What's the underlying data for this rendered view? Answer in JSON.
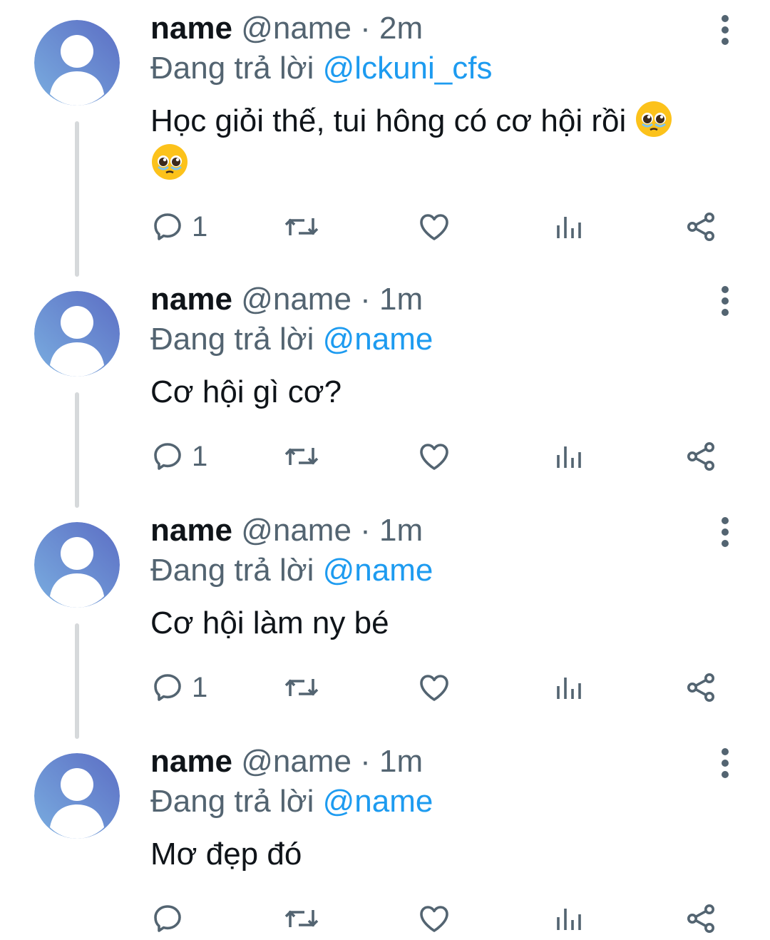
{
  "tweets": [
    {
      "display_name": "name",
      "handle": "@name",
      "separator": " · ",
      "time": "2m",
      "replying_label": "Đang trả lời ",
      "reply_to": "@lckuni_cfs",
      "text": "Học giỏi thế, tui hông có cơ hội rồi",
      "emoji": "🥹 🥹",
      "reply_count": "1"
    },
    {
      "display_name": "name",
      "handle": "@name",
      "separator": " · ",
      "time": "1m",
      "replying_label": "Đang trả lời ",
      "reply_to": "@name",
      "text": "Cơ hội gì cơ?",
      "reply_count": "1"
    },
    {
      "display_name": "name",
      "handle": "@name",
      "separator": " · ",
      "time": "1m",
      "replying_label": "Đang trả lời ",
      "reply_to": "@name",
      "text": "Cơ hội làm ny bé",
      "reply_count": "1"
    },
    {
      "display_name": "name",
      "handle": "@name",
      "separator": " · ",
      "time": "1m",
      "replying_label": "Đang trả lời ",
      "reply_to": "@name",
      "text": "Mơ đẹp đó",
      "reply_count": ""
    }
  ],
  "colors": {
    "text_primary": "#0f1419",
    "text_secondary": "#536471",
    "mention": "#1d9bf0",
    "thread_line": "#d6d9db",
    "avatar_gradient_start": "#7aaee0",
    "avatar_gradient_end": "#5c6ec4"
  },
  "icons": {
    "reply": "speech-bubble-icon",
    "retweet": "retweet-arrows-icon",
    "like": "heart-icon",
    "views": "bar-chart-icon",
    "share": "share-nodes-icon",
    "more": "vertical-ellipsis-icon",
    "avatar": "default-user-silhouette"
  }
}
